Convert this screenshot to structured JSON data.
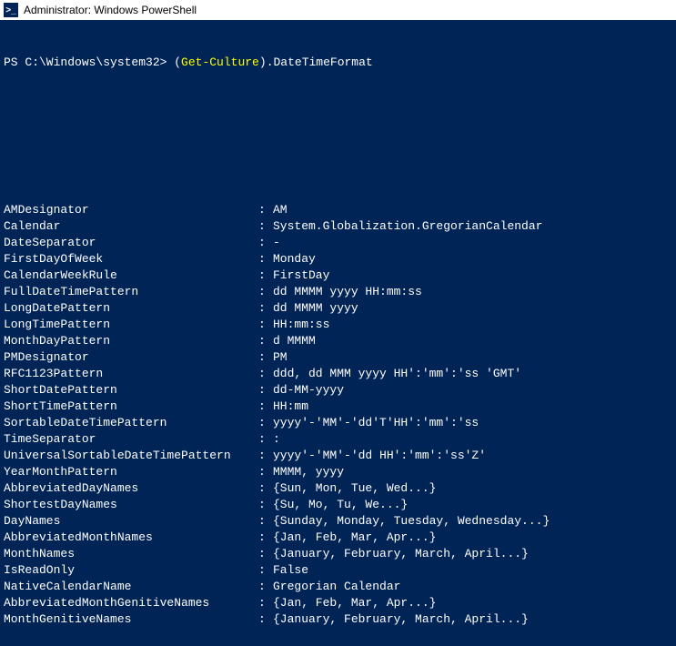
{
  "titlebar": {
    "icon_text": ">_",
    "title": "Administrator: Windows PowerShell"
  },
  "prompt": {
    "prefix": "PS C:\\Windows\\system32> ",
    "lparen": "(",
    "cmdlet": "Get-Culture",
    "rparen": ")",
    "suffix": ".DateTimeFormat"
  },
  "rows": [
    {
      "name": "AMDesignator",
      "value": "AM"
    },
    {
      "name": "Calendar",
      "value": "System.Globalization.GregorianCalendar"
    },
    {
      "name": "DateSeparator",
      "value": "-"
    },
    {
      "name": "FirstDayOfWeek",
      "value": "Monday"
    },
    {
      "name": "CalendarWeekRule",
      "value": "FirstDay"
    },
    {
      "name": "FullDateTimePattern",
      "value": "dd MMMM yyyy HH:mm:ss"
    },
    {
      "name": "LongDatePattern",
      "value": "dd MMMM yyyy"
    },
    {
      "name": "LongTimePattern",
      "value": "HH:mm:ss"
    },
    {
      "name": "MonthDayPattern",
      "value": "d MMMM"
    },
    {
      "name": "PMDesignator",
      "value": "PM"
    },
    {
      "name": "RFC1123Pattern",
      "value": "ddd, dd MMM yyyy HH':'mm':'ss 'GMT'"
    },
    {
      "name": "ShortDatePattern",
      "value": "dd-MM-yyyy"
    },
    {
      "name": "ShortTimePattern",
      "value": "HH:mm"
    },
    {
      "name": "SortableDateTimePattern",
      "value": "yyyy'-'MM'-'dd'T'HH':'mm':'ss"
    },
    {
      "name": "TimeSeparator",
      "value": ":"
    },
    {
      "name": "UniversalSortableDateTimePattern",
      "value": "yyyy'-'MM'-'dd HH':'mm':'ss'Z'"
    },
    {
      "name": "YearMonthPattern",
      "value": "MMMM, yyyy"
    },
    {
      "name": "AbbreviatedDayNames",
      "value": "{Sun, Mon, Tue, Wed...}"
    },
    {
      "name": "ShortestDayNames",
      "value": "{Su, Mo, Tu, We...}"
    },
    {
      "name": "DayNames",
      "value": "{Sunday, Monday, Tuesday, Wednesday...}"
    },
    {
      "name": "AbbreviatedMonthNames",
      "value": "{Jan, Feb, Mar, Apr...}"
    },
    {
      "name": "MonthNames",
      "value": "{January, February, March, April...}"
    },
    {
      "name": "IsReadOnly",
      "value": "False"
    },
    {
      "name": "NativeCalendarName",
      "value": "Gregorian Calendar"
    },
    {
      "name": "AbbreviatedMonthGenitiveNames",
      "value": "{Jan, Feb, Mar, Apr...}"
    },
    {
      "name": "MonthGenitiveNames",
      "value": "{January, February, March, April...}"
    }
  ],
  "separator": ":"
}
